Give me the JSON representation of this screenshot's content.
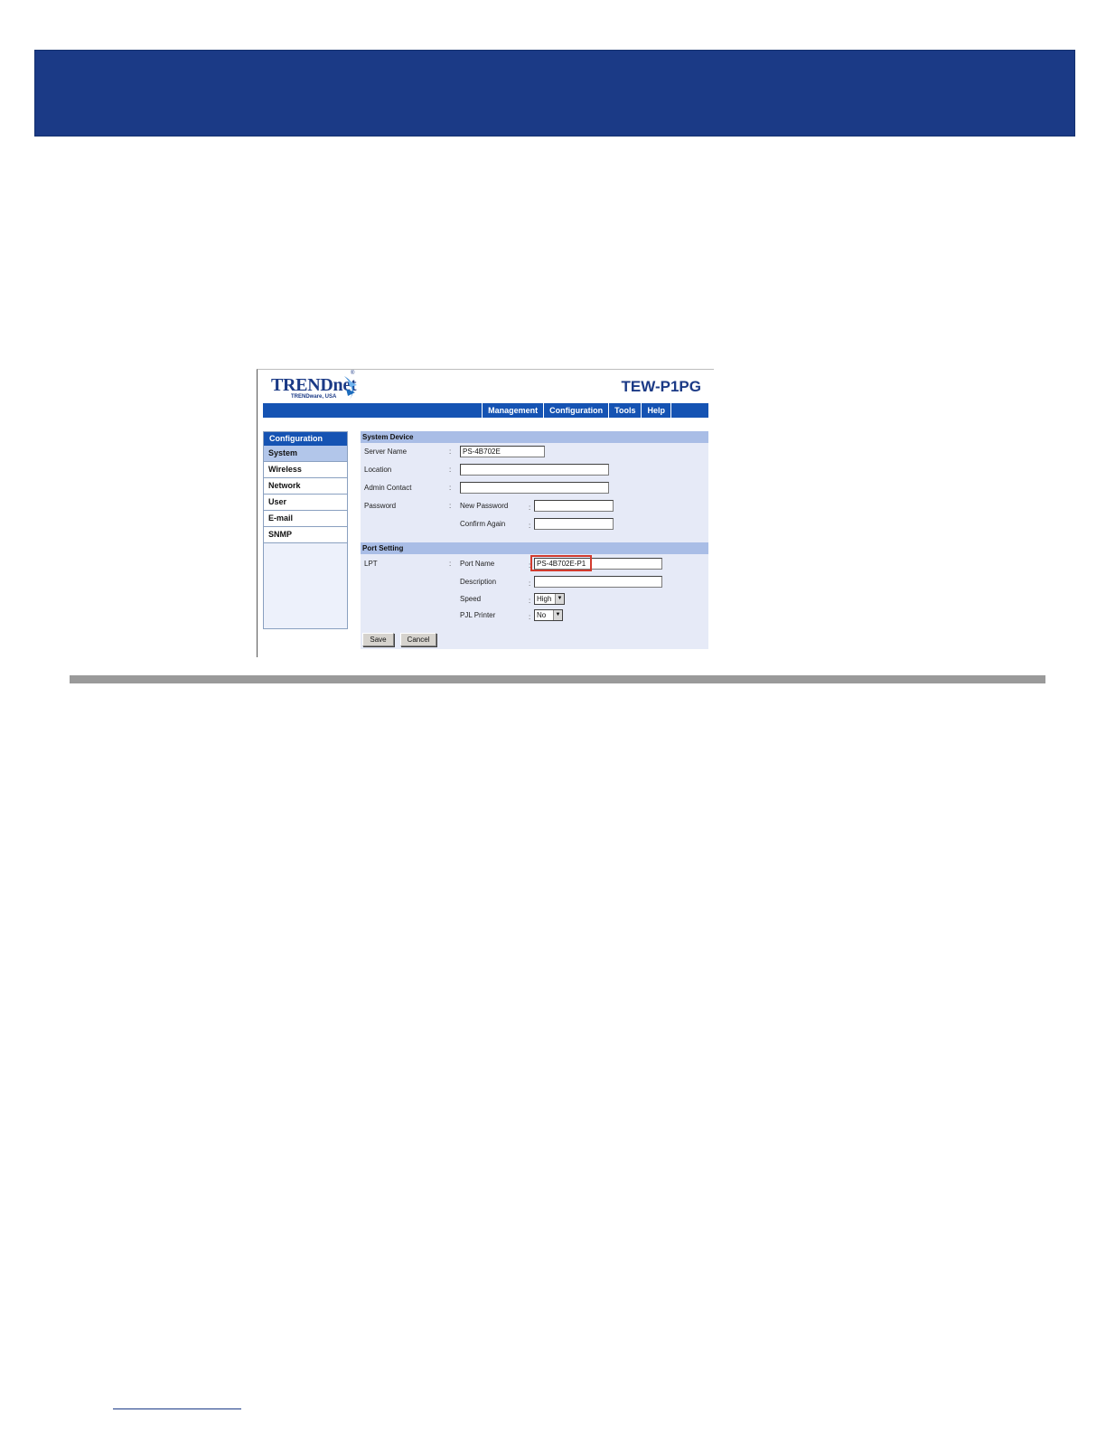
{
  "brand": {
    "logo_text": "TRENDnet",
    "logo_reg": "®",
    "logo_sub": "TRENDware, USA",
    "model": "TEW-P1PG",
    "colors": {
      "primary": "#1b3a86",
      "nav": "#1553b3",
      "section": "#a9bde6",
      "highlight": "#d23b2e"
    }
  },
  "nav": {
    "items": [
      "Management",
      "Configuration",
      "Tools",
      "Help"
    ]
  },
  "sidebar": {
    "header": "Configuration",
    "items": [
      {
        "label": "System",
        "active": true
      },
      {
        "label": "Wireless"
      },
      {
        "label": "Network"
      },
      {
        "label": "User"
      },
      {
        "label": "E-mail"
      },
      {
        "label": "SNMP"
      }
    ]
  },
  "system_device": {
    "header": "System Device",
    "server_name_label": "Server Name",
    "server_name_value": "PS-4B702E",
    "location_label": "Location",
    "location_value": "",
    "admin_contact_label": "Admin Contact",
    "admin_contact_value": "",
    "password_label": "Password",
    "new_password_label": "New Password",
    "confirm_again_label": "Confirm Again"
  },
  "port_setting": {
    "header": "Port Setting",
    "lpt_label": "LPT",
    "port_name_label": "Port Name",
    "port_name_value": "PS-4B702E-P1",
    "description_label": "Description",
    "description_value": "",
    "speed_label": "Speed",
    "speed_value": "High",
    "pjl_label": "PJL Printer",
    "pjl_value": "No"
  },
  "buttons": {
    "save": "Save",
    "cancel": "Cancel"
  },
  "separator": ":"
}
